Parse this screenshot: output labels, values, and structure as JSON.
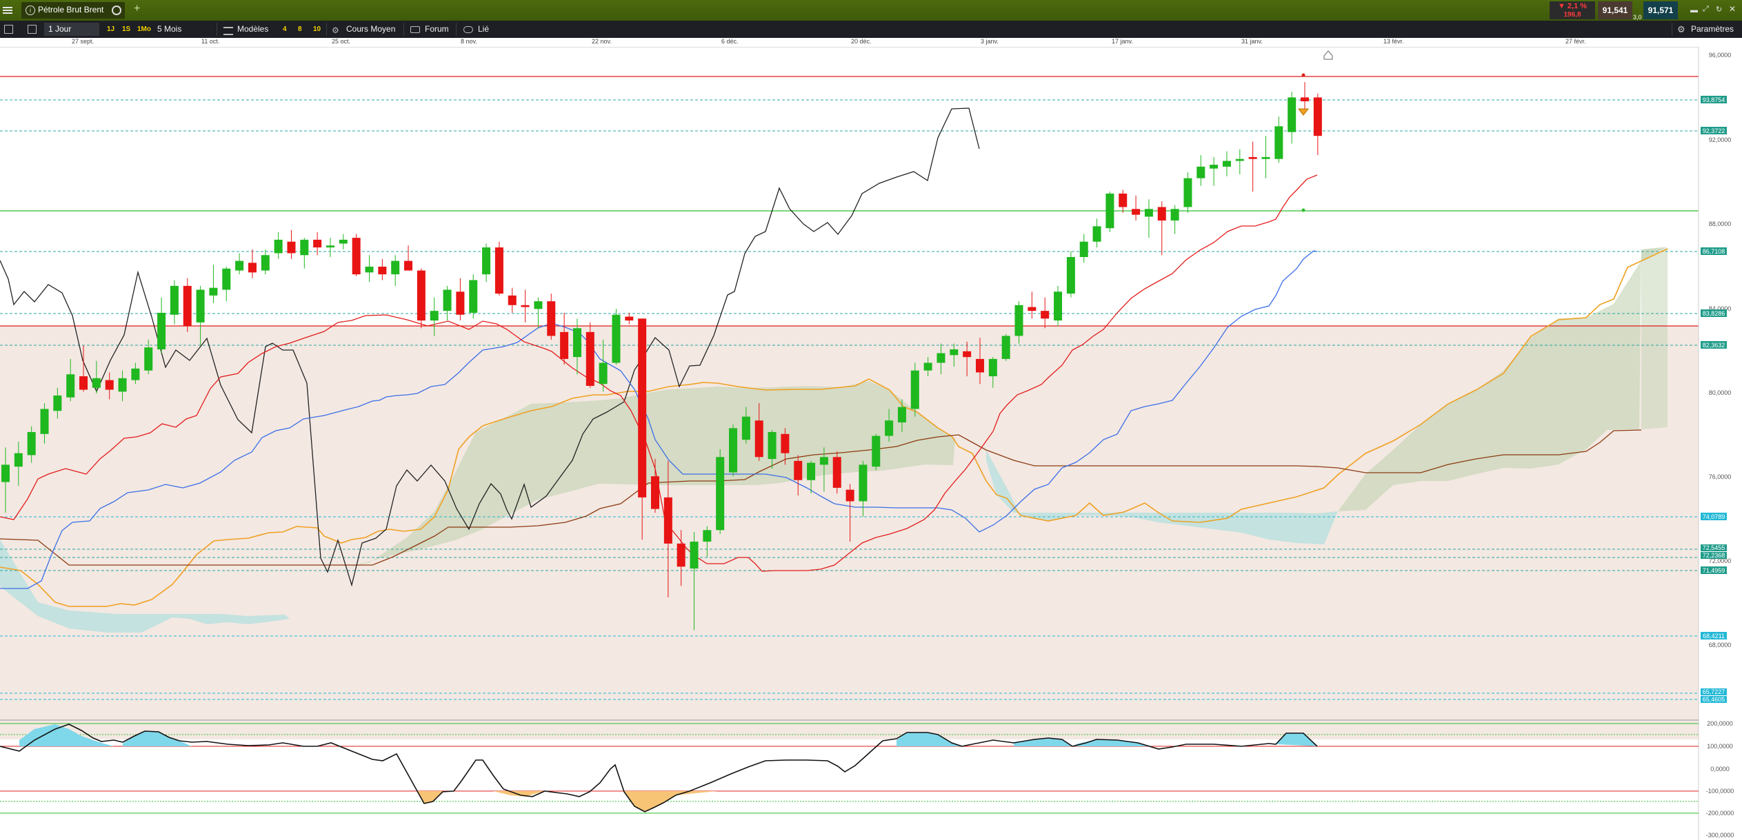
{
  "instrument": {
    "name": "Pétrole Brut Brent"
  },
  "header": {
    "change_pct": "▼ 2,1 %",
    "change_pts": "196,8",
    "bid": "91,541",
    "spread": "3,0",
    "ask": "91,571"
  },
  "toolbar": {
    "period": "1 Jour",
    "range_1j": "1J",
    "range_1s": "1S",
    "range_1mo": "1Mo",
    "range_5m": "5 Mois",
    "models": "Modèles",
    "n4": "4",
    "n8": "8",
    "n10": "10",
    "avg_price": "Cours Moyen",
    "forum": "Forum",
    "linked": "Lié",
    "settings": "Paramètres"
  },
  "dates": [
    "27 sept.",
    "11 oct.",
    "25 oct.",
    "8 nov.",
    "22 nov.",
    "6 déc.",
    "20 déc.",
    "3 janv.",
    "17 janv.",
    "31 janv.",
    "13 févr.",
    "27 févr."
  ],
  "axis": {
    "price_ticks": [
      "96,0000",
      "92,0000",
      "88,0000",
      "84,0000",
      "80,0000",
      "76,0000",
      "72,0000",
      "68,0000"
    ],
    "osc_ticks": [
      "200,0000",
      "100,0000",
      "0,0000",
      "-100,0000",
      "-200,0000",
      "-300,0000"
    ]
  },
  "price_tags": [
    {
      "text": "93,8754",
      "color": "#1f9c8a"
    },
    {
      "text": "92,3722",
      "color": "#1f9c8a"
    },
    {
      "text": "86,7108",
      "color": "#1f9c8a"
    },
    {
      "text": "83,8286",
      "color": "#1f9c8a"
    },
    {
      "text": "82,3632",
      "color": "#1f9c8a"
    },
    {
      "text": "74,0789",
      "color": "#22b8d6"
    },
    {
      "text": "72,5455",
      "color": "#1f9c8a"
    },
    {
      "text": "72,2368",
      "color": "#1f9c8a"
    },
    {
      "text": "71,4959",
      "color": "#1f9c8a"
    },
    {
      "text": "68,4211",
      "color": "#22b8d6"
    },
    {
      "text": "65,7227",
      "color": "#22b8d6"
    },
    {
      "text": "65,4605",
      "color": "#22b8d6"
    }
  ],
  "colors": {
    "up": "#1fb81f",
    "down": "#e81414",
    "tenkan": "#e41a1a",
    "kijun": "#3a6ee8",
    "chikou": "#222222",
    "span_a": "#f0a020",
    "span_b": "#8b3a10",
    "hline_red": "#e01c1c",
    "hline_green": "#2dbd2d",
    "hline_dashed": "#27a6a0"
  },
  "chart_data": {
    "type": "candlestick",
    "ylim": [
      64,
      96
    ],
    "candles": [
      {
        "o": 73.8,
        "h": 75.6,
        "l": 72.2,
        "c": 74.7
      },
      {
        "o": 74.6,
        "h": 75.9,
        "l": 73.6,
        "c": 75.3
      },
      {
        "o": 75.2,
        "h": 76.7,
        "l": 74.8,
        "c": 76.4
      },
      {
        "o": 76.3,
        "h": 77.9,
        "l": 75.8,
        "c": 77.6
      },
      {
        "o": 77.5,
        "h": 78.7,
        "l": 77.1,
        "c": 78.3
      },
      {
        "o": 78.2,
        "h": 80.2,
        "l": 78,
        "c": 79.4
      },
      {
        "o": 79.3,
        "h": 80.9,
        "l": 78.5,
        "c": 78.6
      },
      {
        "o": 78.7,
        "h": 80.1,
        "l": 78.4,
        "c": 79.2
      },
      {
        "o": 79.1,
        "h": 79.5,
        "l": 78.1,
        "c": 78.6
      },
      {
        "o": 78.5,
        "h": 79.6,
        "l": 78,
        "c": 79.2
      },
      {
        "o": 79.1,
        "h": 80,
        "l": 78.9,
        "c": 79.7
      },
      {
        "o": 79.6,
        "h": 81.2,
        "l": 79.4,
        "c": 80.8
      },
      {
        "o": 80.7,
        "h": 83.4,
        "l": 80.5,
        "c": 82.6
      },
      {
        "o": 82.5,
        "h": 84.3,
        "l": 82,
        "c": 84.0
      },
      {
        "o": 84.0,
        "h": 84.4,
        "l": 81.6,
        "c": 81.9
      },
      {
        "o": 82.1,
        "h": 84,
        "l": 80.9,
        "c": 83.8
      },
      {
        "o": 83.5,
        "h": 85.1,
        "l": 83.1,
        "c": 83.9
      },
      {
        "o": 83.8,
        "h": 85,
        "l": 83.2,
        "c": 84.9
      },
      {
        "o": 84.8,
        "h": 85.7,
        "l": 84.6,
        "c": 85.3
      },
      {
        "o": 85.2,
        "h": 85.9,
        "l": 84.4,
        "c": 84.7
      },
      {
        "o": 84.8,
        "h": 85.9,
        "l": 84.6,
        "c": 85.6
      },
      {
        "o": 85.7,
        "h": 86.8,
        "l": 85.4,
        "c": 86.4
      },
      {
        "o": 86.3,
        "h": 86.9,
        "l": 85.4,
        "c": 85.7
      },
      {
        "o": 85.6,
        "h": 86.5,
        "l": 84.9,
        "c": 86.4
      },
      {
        "o": 86.4,
        "h": 86.8,
        "l": 85.6,
        "c": 86.0
      },
      {
        "o": 86.0,
        "h": 86.5,
        "l": 85.5,
        "c": 86.1
      },
      {
        "o": 86.2,
        "h": 86.7,
        "l": 85.9,
        "c": 86.4
      },
      {
        "o": 86.5,
        "h": 86.7,
        "l": 84.5,
        "c": 84.6
      },
      {
        "o": 84.7,
        "h": 85.6,
        "l": 84.2,
        "c": 85.0
      },
      {
        "o": 85.0,
        "h": 85.4,
        "l": 84.3,
        "c": 84.6
      },
      {
        "o": 84.6,
        "h": 85.6,
        "l": 84,
        "c": 85.3
      },
      {
        "o": 85.3,
        "h": 86.1,
        "l": 84.8,
        "c": 84.8
      },
      {
        "o": 84.8,
        "h": 84.9,
        "l": 81.8,
        "c": 82.2
      },
      {
        "o": 82.2,
        "h": 83.4,
        "l": 81.4,
        "c": 82.7
      },
      {
        "o": 82.7,
        "h": 84,
        "l": 82.2,
        "c": 83.8
      },
      {
        "o": 83.7,
        "h": 84.4,
        "l": 82.2,
        "c": 82.5
      },
      {
        "o": 82.6,
        "h": 84.6,
        "l": 82.3,
        "c": 84.3
      },
      {
        "o": 84.6,
        "h": 86.2,
        "l": 84.2,
        "c": 86.0
      },
      {
        "o": 86.0,
        "h": 86.3,
        "l": 83.5,
        "c": 83.6
      },
      {
        "o": 83.5,
        "h": 83.9,
        "l": 82.6,
        "c": 83.0
      },
      {
        "o": 83.0,
        "h": 83.8,
        "l": 82.1,
        "c": 82.9
      },
      {
        "o": 82.8,
        "h": 83.4,
        "l": 81.8,
        "c": 83.2
      },
      {
        "o": 83.2,
        "h": 83.6,
        "l": 81.2,
        "c": 81.4
      },
      {
        "o": 81.6,
        "h": 82.6,
        "l": 79.9,
        "c": 80.2
      },
      {
        "o": 80.3,
        "h": 82.3,
        "l": 79.4,
        "c": 81.8
      },
      {
        "o": 81.6,
        "h": 82.1,
        "l": 78.7,
        "c": 78.8
      },
      {
        "o": 78.9,
        "h": 81.2,
        "l": 78.5,
        "c": 80.0
      },
      {
        "o": 80.0,
        "h": 82.8,
        "l": 79.9,
        "c": 82.5
      },
      {
        "o": 82.4,
        "h": 82.6,
        "l": 82,
        "c": 82.2
      },
      {
        "o": 82.3,
        "h": 82.3,
        "l": 70.8,
        "c": 73.0
      },
      {
        "o": 74.1,
        "h": 75,
        "l": 72.2,
        "c": 72.4
      },
      {
        "o": 73.0,
        "h": 74.9,
        "l": 67.8,
        "c": 70.6
      },
      {
        "o": 70.6,
        "h": 71.3,
        "l": 68.4,
        "c": 69.4
      },
      {
        "o": 69.3,
        "h": 71.2,
        "l": 66.1,
        "c": 70.7
      },
      {
        "o": 70.7,
        "h": 71.5,
        "l": 69.9,
        "c": 71.3
      },
      {
        "o": 71.3,
        "h": 75.5,
        "l": 71.1,
        "c": 75.1
      },
      {
        "o": 74.3,
        "h": 76.8,
        "l": 74.1,
        "c": 76.6
      },
      {
        "o": 76.0,
        "h": 77.7,
        "l": 75.8,
        "c": 77.2
      },
      {
        "o": 77.0,
        "h": 77.9,
        "l": 74.9,
        "c": 75.1
      },
      {
        "o": 75.0,
        "h": 76.5,
        "l": 74.5,
        "c": 76.4
      },
      {
        "o": 76.3,
        "h": 76.6,
        "l": 74.7,
        "c": 75.3
      },
      {
        "o": 74.9,
        "h": 75.2,
        "l": 73.1,
        "c": 73.9
      },
      {
        "o": 73.9,
        "h": 74.9,
        "l": 73.2,
        "c": 74.8
      },
      {
        "o": 74.7,
        "h": 75.6,
        "l": 73.3,
        "c": 75.1
      },
      {
        "o": 75.1,
        "h": 75.4,
        "l": 73.2,
        "c": 73.5
      },
      {
        "o": 73.4,
        "h": 73.7,
        "l": 70.7,
        "c": 72.8
      },
      {
        "o": 72.8,
        "h": 74.9,
        "l": 72.0,
        "c": 74.7
      },
      {
        "o": 74.6,
        "h": 76.3,
        "l": 74.4,
        "c": 76.2
      },
      {
        "o": 76.2,
        "h": 77.6,
        "l": 75.9,
        "c": 77.0
      },
      {
        "o": 76.9,
        "h": 78.1,
        "l": 76.4,
        "c": 77.7
      },
      {
        "o": 77.6,
        "h": 80.0,
        "l": 77.2,
        "c": 79.6
      },
      {
        "o": 79.6,
        "h": 80.3,
        "l": 79.3,
        "c": 80.0
      },
      {
        "o": 80.0,
        "h": 81.0,
        "l": 79.4,
        "c": 80.5
      },
      {
        "o": 80.4,
        "h": 81.0,
        "l": 79.8,
        "c": 80.7
      },
      {
        "o": 80.6,
        "h": 81.1,
        "l": 79.3,
        "c": 80.3
      },
      {
        "o": 80.2,
        "h": 81.3,
        "l": 78.9,
        "c": 79.5
      },
      {
        "o": 79.3,
        "h": 80.3,
        "l": 78.7,
        "c": 80.2
      },
      {
        "o": 80.2,
        "h": 81.5,
        "l": 80.1,
        "c": 81.4
      },
      {
        "o": 81.4,
        "h": 83.2,
        "l": 81.0,
        "c": 83.0
      },
      {
        "o": 82.9,
        "h": 83.7,
        "l": 82.3,
        "c": 82.7
      },
      {
        "o": 82.7,
        "h": 83.4,
        "l": 81.8,
        "c": 82.3
      },
      {
        "o": 82.2,
        "h": 84.0,
        "l": 81.9,
        "c": 83.7
      },
      {
        "o": 83.6,
        "h": 85.8,
        "l": 83.4,
        "c": 85.5
      },
      {
        "o": 85.5,
        "h": 86.7,
        "l": 85.2,
        "c": 86.3
      },
      {
        "o": 86.3,
        "h": 87.5,
        "l": 86.0,
        "c": 87.1
      },
      {
        "o": 87.0,
        "h": 88.9,
        "l": 86.8,
        "c": 88.8
      },
      {
        "o": 88.8,
        "h": 89.0,
        "l": 87.8,
        "c": 88.1
      },
      {
        "o": 88.0,
        "h": 88.7,
        "l": 87.4,
        "c": 87.7
      },
      {
        "o": 87.6,
        "h": 88.5,
        "l": 86.5,
        "c": 88.0
      },
      {
        "o": 88.1,
        "h": 88.4,
        "l": 85.6,
        "c": 87.4
      },
      {
        "o": 87.4,
        "h": 88.2,
        "l": 86.7,
        "c": 88.0
      },
      {
        "o": 88.1,
        "h": 89.9,
        "l": 87.8,
        "c": 89.6
      },
      {
        "o": 89.6,
        "h": 90.8,
        "l": 89.2,
        "c": 90.2
      },
      {
        "o": 90.1,
        "h": 90.7,
        "l": 89.2,
        "c": 90.3
      },
      {
        "o": 90.2,
        "h": 91.0,
        "l": 89.7,
        "c": 90.5
      },
      {
        "o": 90.5,
        "h": 91.1,
        "l": 89.8,
        "c": 90.6
      },
      {
        "o": 90.7,
        "h": 91.5,
        "l": 88.9,
        "c": 90.6
      },
      {
        "o": 90.6,
        "h": 91.8,
        "l": 89.6,
        "c": 90.7
      },
      {
        "o": 90.6,
        "h": 92.8,
        "l": 90.4,
        "c": 92.3
      },
      {
        "o": 92.0,
        "h": 94.1,
        "l": 91.4,
        "c": 93.8
      },
      {
        "o": 93.8,
        "h": 94.6,
        "l": 93.2,
        "c": 93.6
      },
      {
        "o": 93.8,
        "h": 94.0,
        "l": 90.8,
        "c": 91.8
      }
    ]
  }
}
